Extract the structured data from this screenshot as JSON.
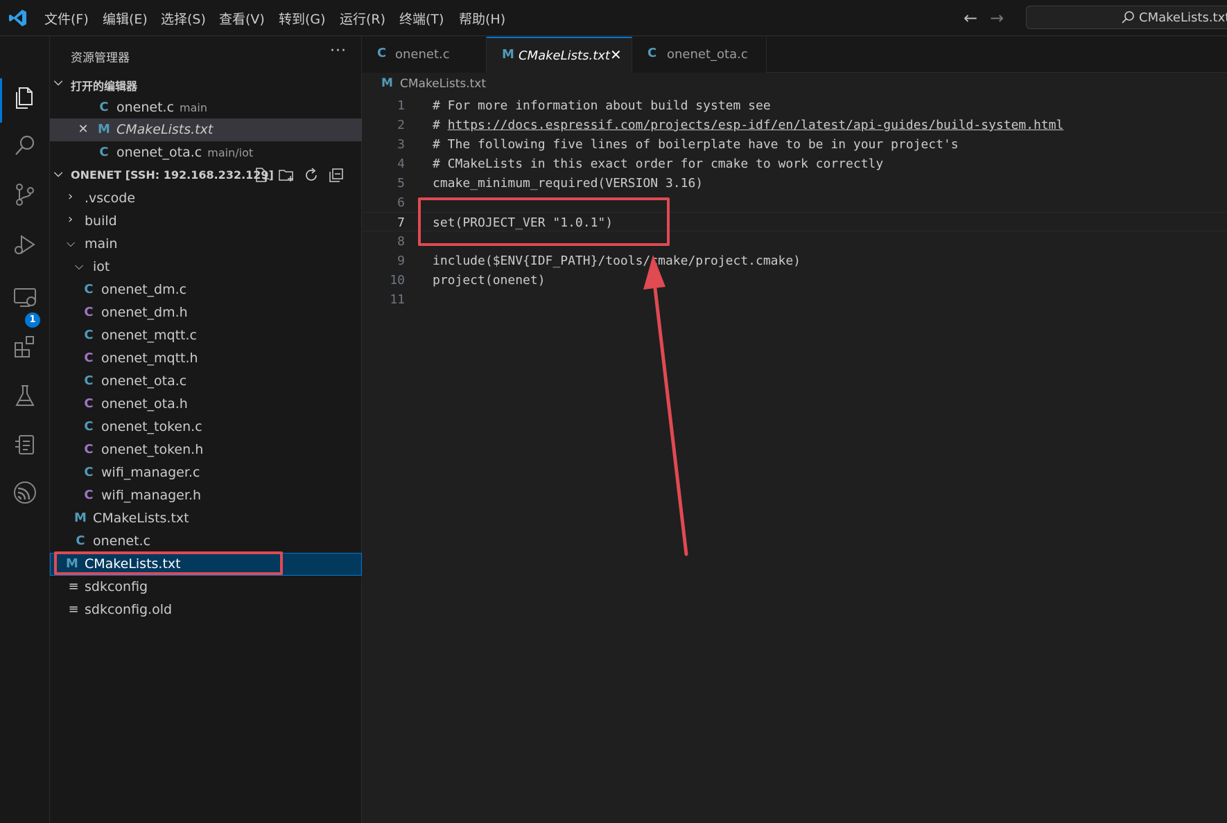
{
  "menu": [
    "文件(F)",
    "编辑(E)",
    "选择(S)",
    "查看(V)",
    "转到(G)",
    "运行(R)",
    "终端(T)",
    "帮助(H)"
  ],
  "command_center": {
    "text": "CMakeLists.txt -"
  },
  "activity_bar": {
    "extensions_badge": "1"
  },
  "sidebar": {
    "title": "资源管理器",
    "more": "···",
    "open_editors": {
      "header": "打开的编辑器",
      "items": [
        {
          "icon": "C",
          "name": "onenet.c",
          "desc": "main"
        },
        {
          "icon": "M",
          "name": "CMakeLists.txt",
          "desc": ""
        },
        {
          "icon": "C",
          "name": "onenet_ota.c",
          "desc": "main/iot"
        }
      ]
    },
    "workspace": {
      "header": "ONENET [SSH: 192.168.232.129]",
      "items": [
        {
          "icon": "chevron-right",
          "name": ".vscode"
        },
        {
          "icon": "chevron-right",
          "name": "build"
        },
        {
          "icon": "chevron-down",
          "name": "main"
        },
        {
          "icon": "chevron-down",
          "name": "iot"
        },
        {
          "icon": "C",
          "name": "onenet_dm.c"
        },
        {
          "icon": "C",
          "name": "onenet_dm.h"
        },
        {
          "icon": "C",
          "name": "onenet_mqtt.c"
        },
        {
          "icon": "C",
          "name": "onenet_mqtt.h"
        },
        {
          "icon": "C",
          "name": "onenet_ota.c"
        },
        {
          "icon": "C",
          "name": "onenet_ota.h"
        },
        {
          "icon": "C",
          "name": "onenet_token.c"
        },
        {
          "icon": "C",
          "name": "onenet_token.h"
        },
        {
          "icon": "C",
          "name": "wifi_manager.c"
        },
        {
          "icon": "C",
          "name": "wifi_manager.h"
        },
        {
          "icon": "M",
          "name": "CMakeLists.txt"
        },
        {
          "icon": "C",
          "name": "onenet.c"
        },
        {
          "icon": "M",
          "name": "CMakeLists.txt"
        },
        {
          "icon": "lines",
          "name": "sdkconfig"
        },
        {
          "icon": "lines",
          "name": "sdkconfig.old"
        }
      ]
    }
  },
  "tabs": [
    {
      "icon": "C",
      "label": "onenet.c"
    },
    {
      "icon": "M",
      "label": "CMakeLists.txt",
      "close": "✕"
    },
    {
      "icon": "C",
      "label": "onenet_ota.c"
    }
  ],
  "breadcrumb": {
    "icon": "M",
    "label": "CMakeLists.txt"
  },
  "code": {
    "lines": [
      {
        "n": "1",
        "text": "# For more information about build system see"
      },
      {
        "n": "2",
        "prefix": "# ",
        "link": "https://docs.espressif.com/projects/esp-idf/en/latest/api-guides/build-system.html"
      },
      {
        "n": "3",
        "text": "# The following five lines of boilerplate have to be in your project's"
      },
      {
        "n": "4",
        "text": "# CMakeLists in this exact order for cmake to work correctly"
      },
      {
        "n": "5",
        "text": "cmake_minimum_required(VERSION 3.16)"
      },
      {
        "n": "6",
        "text": ""
      },
      {
        "n": "7",
        "text": "set(PROJECT_VER \"1.0.1\")"
      },
      {
        "n": "8",
        "text": ""
      },
      {
        "n": "9",
        "text": "include($ENV{IDF_PATH}/tools/cmake/project.cmake)"
      },
      {
        "n": "10",
        "text": "project(onenet)"
      },
      {
        "n": "11",
        "text": ""
      }
    ]
  },
  "colors": {
    "accent": "#0078d4",
    "annotation": "#e04a52",
    "c_icon": "#519aba",
    "h_icon": "#a074c4"
  }
}
